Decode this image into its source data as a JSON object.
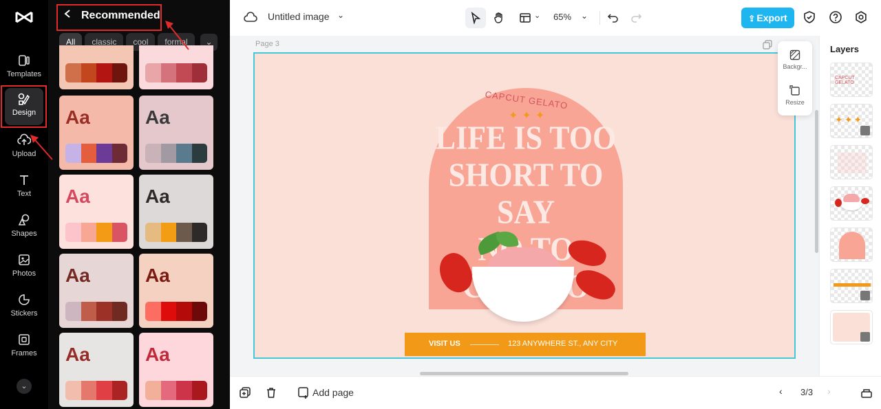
{
  "rail": {
    "items": [
      {
        "label": "Templates"
      },
      {
        "label": "Design"
      },
      {
        "label": "Upload"
      },
      {
        "label": "Text"
      },
      {
        "label": "Shapes"
      },
      {
        "label": "Photos"
      },
      {
        "label": "Stickers"
      },
      {
        "label": "Frames"
      }
    ]
  },
  "panel": {
    "title": "Recommended",
    "chips": [
      "All",
      "classic",
      "cool",
      "formal"
    ],
    "card_text": "Aa",
    "cards_top": [
      {
        "swatches": [
          "#d0704a",
          "#c2471e",
          "#b31612",
          "#6e160e"
        ],
        "bg": "#f4c6b4"
      },
      {
        "swatches": [
          "#e8a6a8",
          "#d4737b",
          "#c24a55",
          "#9e2f39"
        ],
        "bg": "#fbdadd"
      }
    ],
    "cards": [
      {
        "bg": "#f4b9a9",
        "aa_color": "#9a2d24",
        "swatches": [
          "#c5b3e8",
          "#e45d3c",
          "#6c3a97",
          "#6e2a35"
        ]
      },
      {
        "bg": "#e5c8cc",
        "aa_color": "#39383a",
        "swatches": [
          "#c9b2b8",
          "#a29aa2",
          "#5a7a8e",
          "#2c3b3e"
        ]
      },
      {
        "bg": "#fde1dc",
        "aa_color": "#d5495f",
        "swatches": [
          "#fdc5cb",
          "#f7a793",
          "#f39a17",
          "#d95563"
        ]
      },
      {
        "bg": "#dcd9d8",
        "aa_color": "#2f2b2a",
        "swatches": [
          "#e6bb81",
          "#f29d13",
          "#6c5a4c",
          "#2d2a28"
        ]
      },
      {
        "bg": "#e6d7d6",
        "aa_color": "#762823",
        "swatches": [
          "#ceb6c1",
          "#c05c4a",
          "#9b3127",
          "#6f2a21"
        ]
      },
      {
        "bg": "#f5d1c2",
        "aa_color": "#7c1b12",
        "swatches": [
          "#fe6d61",
          "#de0c0b",
          "#b40a0a",
          "#6e0909"
        ]
      },
      {
        "bg": "#e7e4e4",
        "aa_color": "#972c27",
        "swatches": [
          "#f2bdad",
          "#e5786d",
          "#e04043",
          "#aa2424"
        ]
      },
      {
        "bg": "#fed7dc",
        "aa_color": "#c02a3a",
        "swatches": [
          "#f2b09b",
          "#e5697c",
          "#ce3449",
          "#a9181c"
        ]
      }
    ]
  },
  "topbar": {
    "title": "Untitled image",
    "zoom": "65%",
    "export_label": "Export"
  },
  "canvas": {
    "page_label": "Page 3",
    "brand": "CAPCUT GELATO",
    "stars": "✦✦✦",
    "headline": [
      "LIFE IS TOO",
      "SHORT TO SAY",
      "NO TO GELATO"
    ],
    "banner_visit": "VISIT US",
    "banner_address": "123 ANYWHERE ST., ANY CITY"
  },
  "floattools": {
    "background_label": "Backgr...",
    "resize_label": "Resize"
  },
  "layers": {
    "title": "Layers"
  },
  "bottombar": {
    "add_page_label": "Add page",
    "pager": "3/3"
  },
  "colors": {
    "accent": "#1eb6f0",
    "selection": "#45c7d8",
    "annotation": "#e12a2a"
  }
}
